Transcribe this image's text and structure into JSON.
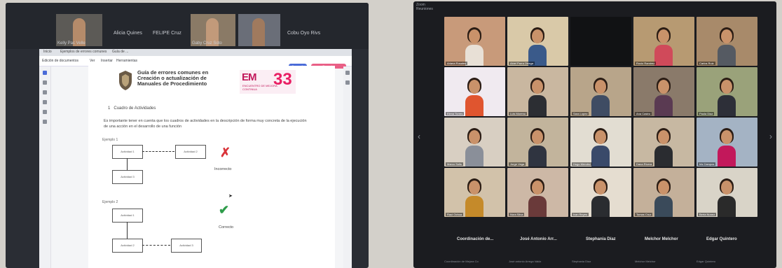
{
  "left_screen": {
    "window_tabs": [
      "Inicio",
      "Ejemplos de errores comunes",
      "Guía de ..."
    ],
    "menu_items": [
      "Edición de documentos",
      "Ver",
      "Insertar",
      "Herramientas"
    ],
    "share_labels": [
      "Compartir",
      "Presentar"
    ],
    "participants": [
      {
        "name": "Kelly Pac Velle"
      },
      {
        "name": "Alicia Quines"
      },
      {
        "name": "FELIPE Cruz"
      },
      {
        "name": "Gaby Cruz Soto"
      },
      {
        "name": "Cobu Oyo Rivs"
      }
    ],
    "doc": {
      "title": "Guía de errores comunes en Creación o actualización de Manuales de Procedimiento",
      "logo_em": "EM",
      "logo_33": "33",
      "logo_sub": "ENCUENTRO DE MEJORA CONTINUA",
      "section_number": "1",
      "section_heading": "Cuadro de Actividades",
      "paragraph": "Es importante tener en cuenta que los cuadros de actividades en la descripción de forma muy concreta de la ejecución de una acción en el desarrollo de una función",
      "example_1": "Ejemplo 1",
      "example_2": "Ejemplo 2",
      "activity_labels": [
        "Actividad 1",
        "Actividad 2",
        "Actividad 3",
        "Actividad 1",
        "Actividad 2",
        "Actividad 3"
      ],
      "incorrect_label": "Incorrecto",
      "correct_label": "Correcto"
    }
  },
  "right_screen": {
    "title_bar": "Zoom\nReuniones",
    "participants": [
      {
        "name": "Ariana Rosales",
        "bg": "#c89a7a",
        "shirt": "#e8e0d6"
      },
      {
        "name": "Abiel Parra Ortega",
        "bg": "#d9c9a8",
        "shirt": "#3a5a8a"
      },
      {
        "name": "",
        "bg": "#111214",
        "shirt": "#111214"
      },
      {
        "name": "Rocio Ramirez",
        "bg": "#b79a72",
        "shirt": "#d04a5a"
      },
      {
        "name": "Carlos Ruiz",
        "bg": "#a88a6a",
        "shirt": "#555a62"
      },
      {
        "name": "Elena Torres",
        "bg": "#f0eaf0",
        "shirt": "#e0552f"
      },
      {
        "name": "Luis Moreno",
        "bg": "#c9b7a0",
        "shirt": "#2c2e33"
      },
      {
        "name": "Sara Lopez",
        "bg": "#b8a58a",
        "shirt": "#3f4c63"
      },
      {
        "name": "Ana Castro",
        "bg": "#8a7a6a",
        "shirt": "#5a3a52"
      },
      {
        "name": "Paola Diaz",
        "bg": "#9aa27a",
        "shirt": "#2d2f38"
      },
      {
        "name": "Marco Solis",
        "bg": "#d8cfc2",
        "shirt": "#8a8f99"
      },
      {
        "name": "Jorge Vega",
        "bg": "#c2b49c",
        "shirt": "#2f3440"
      },
      {
        "name": "Hugo Mendez",
        "bg": "#e2ddd2",
        "shirt": "#3a4a6a"
      },
      {
        "name": "Dana Rivera",
        "bg": "#c7b8a2",
        "shirt": "#2a2c30"
      },
      {
        "name": "Iris Campos",
        "bg": "#a4b3c4",
        "shirt": "#c2185b"
      },
      {
        "name": "Raul Ochoa",
        "bg": "#d2c2aa",
        "shirt": "#c58a2a"
      },
      {
        "name": "Nora Silva",
        "bg": "#cdb8a6",
        "shirt": "#6a3a3a"
      },
      {
        "name": "Ivan Reyes",
        "bg": "#e5ddd0",
        "shirt": "#2a2c30"
      },
      {
        "name": "Tomas Cruz",
        "bg": "#c4b09a",
        "shirt": "#3a4a5a"
      },
      {
        "name": "Berta Nunez",
        "bg": "#d9d4c8",
        "shirt": "#2a2a2a"
      }
    ],
    "bottom_names": [
      "Coordinación de...",
      "José Antonio Arr...",
      "Stephania Díaz",
      "Melchor Melchor",
      "Edgar Quintero"
    ],
    "bottom_subs": [
      "Coordinación de Mejora Co",
      "José antonio Arrega Valdz",
      "Stephania Díaz",
      "Melchor Melchor",
      "Edgar Quintero"
    ]
  }
}
